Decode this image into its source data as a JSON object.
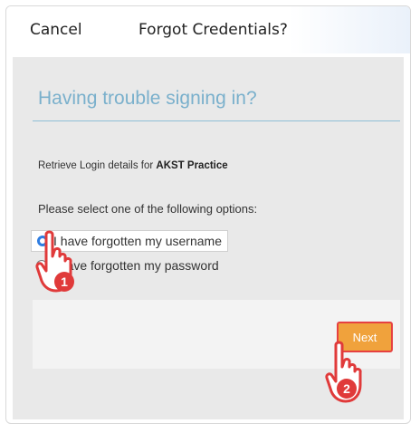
{
  "header": {
    "cancel_label": "Cancel",
    "title": "Forgot Credentials?"
  },
  "main": {
    "heading": "Having trouble signing in?",
    "retrieve_prefix": "Retrieve Login details for ",
    "retrieve_org": "AKST Practice",
    "prompt": "Please select one of the following options:",
    "options": [
      {
        "label": "I have forgotten my username",
        "selected": true
      },
      {
        "label": "I have forgotten my password",
        "selected": false
      }
    ],
    "next_label": "Next"
  },
  "annotations": {
    "step1": "1",
    "step2": "2"
  },
  "colors": {
    "accent": "#7ab0cc",
    "button": "#f0a23c",
    "highlight": "#e64040",
    "radio": "#2f7de1"
  }
}
